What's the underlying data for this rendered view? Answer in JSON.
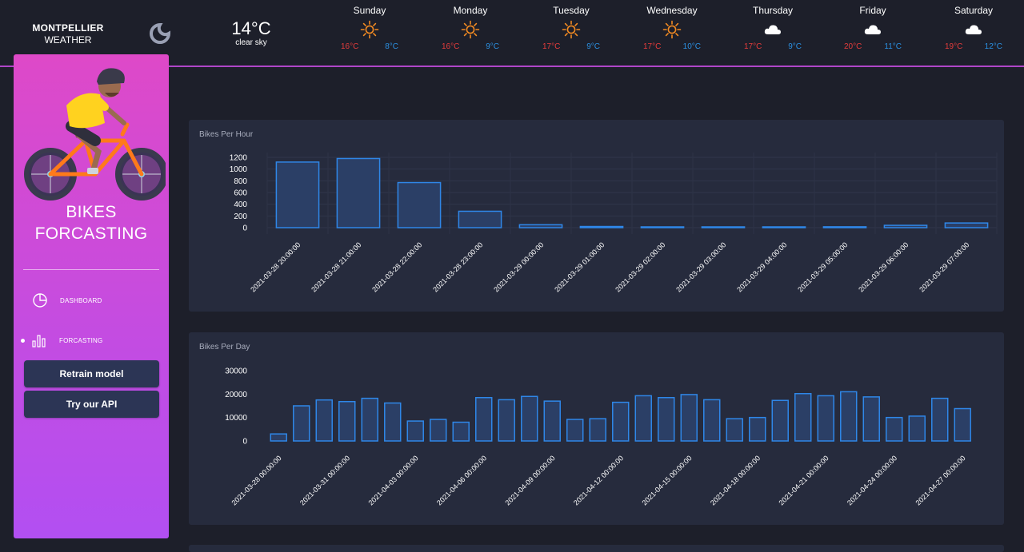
{
  "brand": {
    "city": "MONTPELLIER",
    "subtitle": "WEATHER"
  },
  "current": {
    "temperature": "14°C",
    "description": "clear sky"
  },
  "forecast": [
    {
      "day": "Sunday",
      "icon": "sun-icon",
      "max": "16°C",
      "min": "8°C"
    },
    {
      "day": "Monday",
      "icon": "sun-icon",
      "max": "16°C",
      "min": "9°C"
    },
    {
      "day": "Tuesday",
      "icon": "sun-icon",
      "max": "17°C",
      "min": "9°C"
    },
    {
      "day": "Wednesday",
      "icon": "sun-icon",
      "max": "17°C",
      "min": "10°C"
    },
    {
      "day": "Thursday",
      "icon": "cloud-icon",
      "max": "17°C",
      "min": "9°C"
    },
    {
      "day": "Friday",
      "icon": "cloud-icon",
      "max": "20°C",
      "min": "11°C"
    },
    {
      "day": "Saturday",
      "icon": "cloud-icon",
      "max": "19°C",
      "min": "12°C"
    }
  ],
  "sidebar": {
    "title_line1": "BIKES",
    "title_line2": "FORCASTING",
    "nav": [
      {
        "label": "DASHBOARD",
        "icon": "pie-chart-icon",
        "active": false
      },
      {
        "label": "FORCASTING",
        "icon": "bar-chart-icon",
        "active": true
      }
    ],
    "buttons": {
      "retrain": "Retrain model",
      "api": "Try our API"
    }
  },
  "colors": {
    "accent": "#b046c8",
    "bar_stroke": "#2f87e8",
    "bar_fill": "#2b3f66",
    "card": "#262b3d",
    "background": "#1d1f2a",
    "temp_max": "#e53c3c",
    "temp_min": "#2b8fe0"
  },
  "chart_data": [
    {
      "type": "bar",
      "title": "Bikes Per Hour",
      "categories": [
        "2021-03-28 20:00:00",
        "2021-03-28 21:00:00",
        "2021-03-28 22:00:00",
        "2021-03-28 23:00:00",
        "2021-03-29 00:00:00",
        "2021-03-29 01:00:00",
        "2021-03-29 02:00:00",
        "2021-03-29 03:00:00",
        "2021-03-29 04:00:00",
        "2021-03-29 05:00:00",
        "2021-03-29 06:00:00",
        "2021-03-29 07:00:00"
      ],
      "values": [
        1120,
        1180,
        770,
        280,
        50,
        20,
        10,
        5,
        5,
        15,
        40,
        80
      ],
      "yticks": [
        "1200",
        "1000",
        "800",
        "600",
        "400",
        "200",
        "0"
      ],
      "ylim": [
        0,
        1200
      ],
      "grid": true
    },
    {
      "type": "bar",
      "title": "Bikes Per Day",
      "categories": [
        "2021-03-28 00:00:00",
        "2021-03-29 00:00:00",
        "2021-03-30 00:00:00",
        "2021-03-31 00:00:00",
        "2021-04-01 00:00:00",
        "2021-04-02 00:00:00",
        "2021-04-03 00:00:00",
        "2021-04-04 00:00:00",
        "2021-04-05 00:00:00",
        "2021-04-06 00:00:00",
        "2021-04-07 00:00:00",
        "2021-04-08 00:00:00",
        "2021-04-09 00:00:00",
        "2021-04-10 00:00:00",
        "2021-04-11 00:00:00",
        "2021-04-12 00:00:00",
        "2021-04-13 00:00:00",
        "2021-04-14 00:00:00",
        "2021-04-15 00:00:00",
        "2021-04-16 00:00:00",
        "2021-04-17 00:00:00",
        "2021-04-18 00:00:00",
        "2021-04-19 00:00:00",
        "2021-04-20 00:00:00",
        "2021-04-21 00:00:00",
        "2021-04-22 00:00:00",
        "2021-04-23 00:00:00",
        "2021-04-24 00:00:00",
        "2021-04-25 00:00:00",
        "2021-04-26 00:00:00",
        "2021-04-27 00:00:00",
        "2021-04-28 00:00:00"
      ],
      "values": [
        3000,
        15000,
        17500,
        16800,
        18200,
        16200,
        8500,
        9200,
        8000,
        18500,
        17600,
        19000,
        17000,
        9200,
        9500,
        16500,
        19300,
        18500,
        19800,
        17600,
        9500,
        10000,
        17300,
        20200,
        19300,
        21000,
        18800,
        10000,
        10600,
        18200,
        13800
      ],
      "xtick_labels": [
        "2021-03-28 00:00:00",
        "2021-03-31 00:00:00",
        "2021-04-03 00:00:00",
        "2021-04-06 00:00:00",
        "2021-04-09 00:00:00",
        "2021-04-12 00:00:00",
        "2021-04-15 00:00:00",
        "2021-04-18 00:00:00",
        "2021-04-21 00:00:00",
        "2021-04-24 00:00:00",
        "2021-04-27 00:00:00"
      ],
      "yticks": [
        "30000",
        "20000",
        "10000",
        "0"
      ],
      "ylim": [
        0,
        30000
      ],
      "grid": false
    }
  ]
}
